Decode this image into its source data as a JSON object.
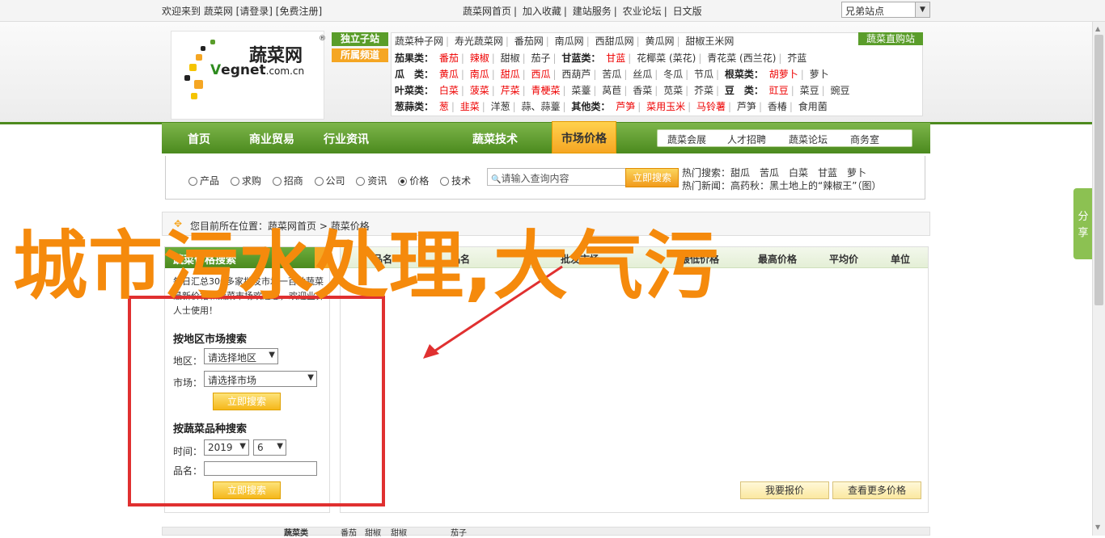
{
  "topbar": {
    "welcome": "欢迎来到 蔬菜网 [请登录] [免费注册]",
    "links": [
      "蔬菜网首页",
      "加入收藏",
      "建站服务",
      "农业论坛",
      "日文版"
    ],
    "select_value": "兄弟站点"
  },
  "logo": {
    "cn": "蔬菜网",
    "en_prefix": "V",
    "en_rest": "egnet",
    "en_suffix": ".com.cn",
    "reg": "®"
  },
  "tags": [
    "独立子站",
    "所属频道"
  ],
  "cats": {
    "row1": [
      "蔬菜种子网",
      "寿光蔬菜网",
      "番茄网",
      "南瓜网",
      "西甜瓜网",
      "黄瓜网",
      "甜椒王米网"
    ],
    "row2": {
      "label": "茄果类：",
      "items": [
        "番茄",
        "辣椒",
        "甜椒",
        "茄子"
      ],
      "label2": "甘蓝类：",
      "items2": [
        "甘蓝",
        "花椰菜 (菜花)",
        "青花菜 (西兰花)",
        "芥蓝"
      ]
    },
    "row3": {
      "label": "瓜　类：",
      "items": [
        "黄瓜",
        "南瓜",
        "甜瓜",
        "西瓜",
        "西葫芦",
        "苦瓜",
        "丝瓜",
        "冬瓜",
        "节瓜"
      ],
      "label2": "根菜类：",
      "items2": [
        "胡萝卜",
        "萝卜"
      ]
    },
    "row4": {
      "label": "叶菜类：",
      "items": [
        "白菜",
        "菠菜",
        "芹菜",
        "青梗菜",
        "菜薹",
        "莴苣",
        "香菜",
        "苋菜",
        "芥菜"
      ],
      "label2": "豆　类：",
      "items2": [
        "豇豆",
        "菜豆",
        "豌豆"
      ]
    },
    "row5": {
      "label": "葱蒜类：",
      "items": [
        "葱",
        "韭菜",
        "洋葱",
        "蒜、蒜薹"
      ],
      "label2": "其他类：",
      "items2": [
        "芦笋",
        "菜用玉米",
        "马铃薯",
        "芦笋",
        "香椿",
        "食用菌"
      ]
    }
  },
  "direct_label": "蔬菜直购站",
  "mainnav": [
    "首页",
    "商业贸易",
    "行业资讯",
    "市场价格",
    "蔬菜技术"
  ],
  "subnav": [
    "蔬菜会展",
    "人才招聘",
    "蔬菜论坛",
    "商务室"
  ],
  "search": {
    "options": [
      "产品",
      "求购",
      "招商",
      "公司",
      "资讯",
      "价格",
      "技术"
    ],
    "selected": "价格",
    "placeholder": "请输入查询内容",
    "button": "立即搜索",
    "hot_label": "热门搜索：",
    "hot_items": "甜瓜　苦瓜　白菜　甘蓝　萝卜",
    "news_label": "热门新闻：",
    "news_item": "高药秋：黑土地上的“辣椒王”（图）"
  },
  "crumb": {
    "prefix": "您目前所在位置：",
    "home": "蔬菜网首页",
    "sep": ">",
    "current": "蔬菜价格"
  },
  "left": {
    "title": "蔬菜价格搜索",
    "desc": "每日汇总300多家批发市场一百种蔬菜最新价格和蔬菜市场欢迎您，欢迎业界人士使用！",
    "region_title": "按地区市场搜索",
    "region_label": "地区：",
    "region_value": "请选择地区",
    "market_label": "市场：",
    "market_value": "请选择市场",
    "button1": "立即搜索",
    "variety_title": "按蔬菜品种搜索",
    "time_label": "时间：",
    "year": "2019",
    "month": "6",
    "name_label": "品名：",
    "button2": "立即搜索"
  },
  "right": {
    "headers": [
      "品名",
      "品名",
      "批发市场",
      "最低价格",
      "最高价格",
      "平均价",
      "单位"
    ],
    "btn_quote": "我要报价",
    "btn_more": "查看更多价格"
  },
  "bottom": {
    "title": "蔬菜类",
    "items": [
      "番茄",
      "甜椒",
      "甜椒",
      "茄子"
    ]
  },
  "share": "分享",
  "overlay_text": "城市污水处理,大气污",
  "colors": {
    "brand_green": "#4b8a1e",
    "accent_orange": "#f5a623",
    "overlay": "#f58a0c",
    "annotation_red": "#e03030"
  }
}
